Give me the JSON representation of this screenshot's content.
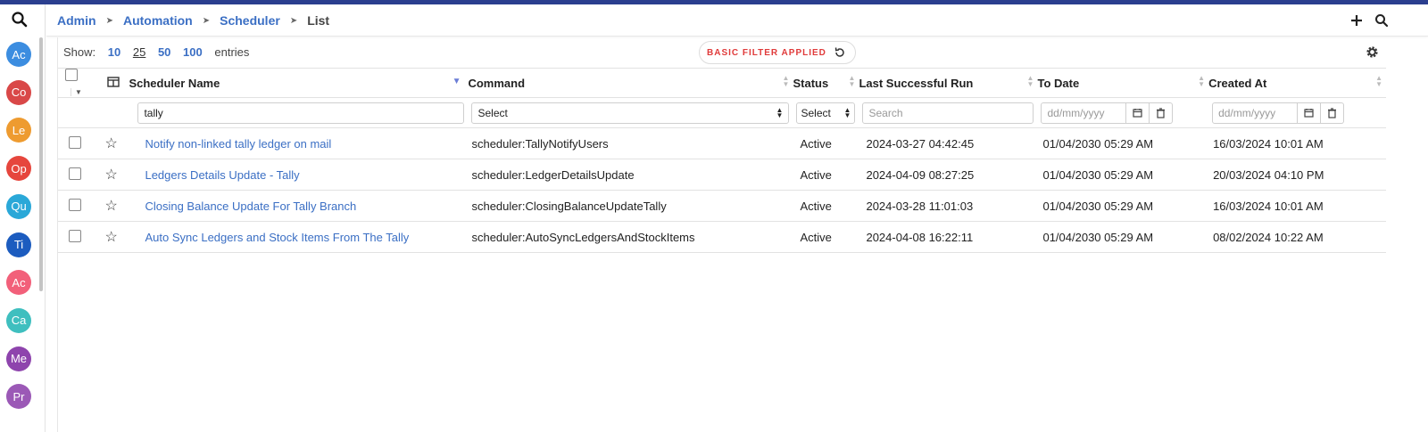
{
  "sidebar": {
    "avatars": [
      {
        "label": "Ac",
        "color": "#3c8de0"
      },
      {
        "label": "Co",
        "color": "#d94848"
      },
      {
        "label": "Le",
        "color": "#ee9b30"
      },
      {
        "label": "Op",
        "color": "#e6463d"
      },
      {
        "label": "Qu",
        "color": "#2aa8d8"
      },
      {
        "label": "Ti",
        "color": "#1c5cbf"
      },
      {
        "label": "Ac",
        "color": "#f2607a"
      },
      {
        "label": "Ca",
        "color": "#3fbfbf"
      },
      {
        "label": "Me",
        "color": "#8e44ad"
      },
      {
        "label": "Pr",
        "color": "#9b59b6"
      }
    ]
  },
  "breadcrumb": {
    "items": [
      "Admin",
      "Automation",
      "Scheduler"
    ],
    "current": "List"
  },
  "show": {
    "label": "Show:",
    "options": [
      "10",
      "25",
      "50",
      "100"
    ],
    "selected": "25",
    "suffix": "entries"
  },
  "filter_badge": "BASIC FILTER APPLIED",
  "columns": {
    "name": "Scheduler Name",
    "command": "Command",
    "status": "Status",
    "last_run": "Last Successful Run",
    "to_date": "To Date",
    "created_at": "Created At"
  },
  "filters": {
    "name_value": "tally",
    "command_select": "Select",
    "status_select": "Select",
    "last_run_placeholder": "Search",
    "date_placeholder": "dd/mm/yyyy"
  },
  "rows": [
    {
      "name": "Notify non-linked tally ledger on mail",
      "command": "scheduler:TallyNotifyUsers",
      "status": "Active",
      "last_run": "2024-03-27 04:42:45",
      "to_date": "01/04/2030 05:29 AM",
      "created_at": "16/03/2024 10:01 AM"
    },
    {
      "name": "Ledgers Details Update - Tally",
      "command": "scheduler:LedgerDetailsUpdate",
      "status": "Active",
      "last_run": "2024-04-09 08:27:25",
      "to_date": "01/04/2030 05:29 AM",
      "created_at": "20/03/2024 04:10 PM"
    },
    {
      "name": "Closing Balance Update For Tally Branch",
      "command": "scheduler:ClosingBalanceUpdateTally",
      "status": "Active",
      "last_run": "2024-03-28 11:01:03",
      "to_date": "01/04/2030 05:29 AM",
      "created_at": "16/03/2024 10:01 AM"
    },
    {
      "name": "Auto Sync Ledgers and Stock Items From The Tally",
      "command": "scheduler:AutoSyncLedgersAndStockItems",
      "status": "Active",
      "last_run": "2024-04-08 16:22:11",
      "to_date": "01/04/2030 05:29 AM",
      "created_at": "08/02/2024 10:22 AM"
    }
  ]
}
